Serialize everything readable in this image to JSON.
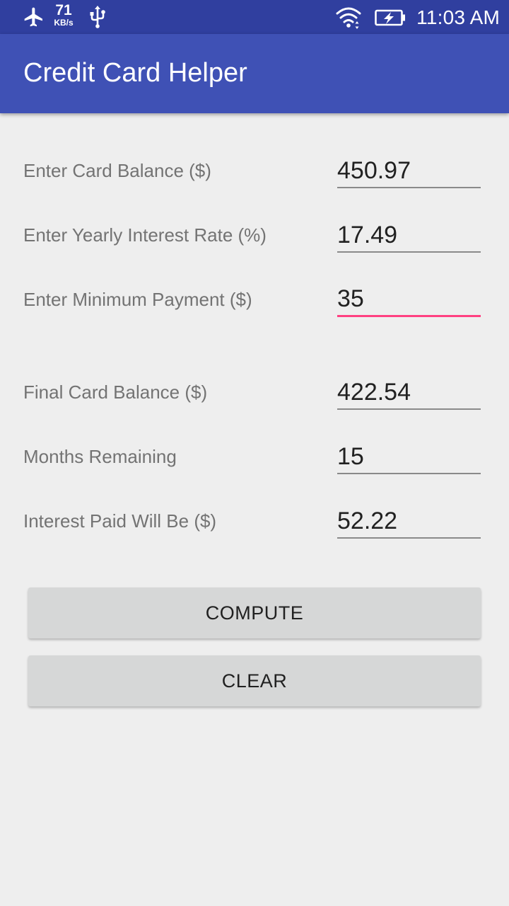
{
  "status_bar": {
    "network_speed_value": "71",
    "network_speed_unit": "KB/s",
    "time": "11:03 AM",
    "icons": [
      "airplane-mode-icon",
      "usb-icon",
      "wifi-icon",
      "battery-charging-icon"
    ]
  },
  "app_bar": {
    "title": "Credit Card Helper",
    "color": "#3f51b5"
  },
  "form": {
    "card_balance": {
      "label": "Enter Card Balance ($)",
      "value": "450.97"
    },
    "interest_rate": {
      "label": "Enter Yearly Interest Rate (%)",
      "value": "17.49"
    },
    "minimum_payment": {
      "label": "Enter Minimum Payment ($)",
      "value": "35"
    }
  },
  "results": {
    "final_balance": {
      "label": "Final Card Balance ($)",
      "value": "422.54"
    },
    "months_remaining": {
      "label": "Months Remaining",
      "value": "15"
    },
    "interest_paid": {
      "label": "Interest Paid Will Be ($)",
      "value": "52.22"
    }
  },
  "buttons": {
    "compute_label": "COMPUTE",
    "clear_label": "CLEAR"
  },
  "colors": {
    "status_bar": "#303f9f",
    "accent": "#ff4081",
    "background": "#eeeeee"
  }
}
